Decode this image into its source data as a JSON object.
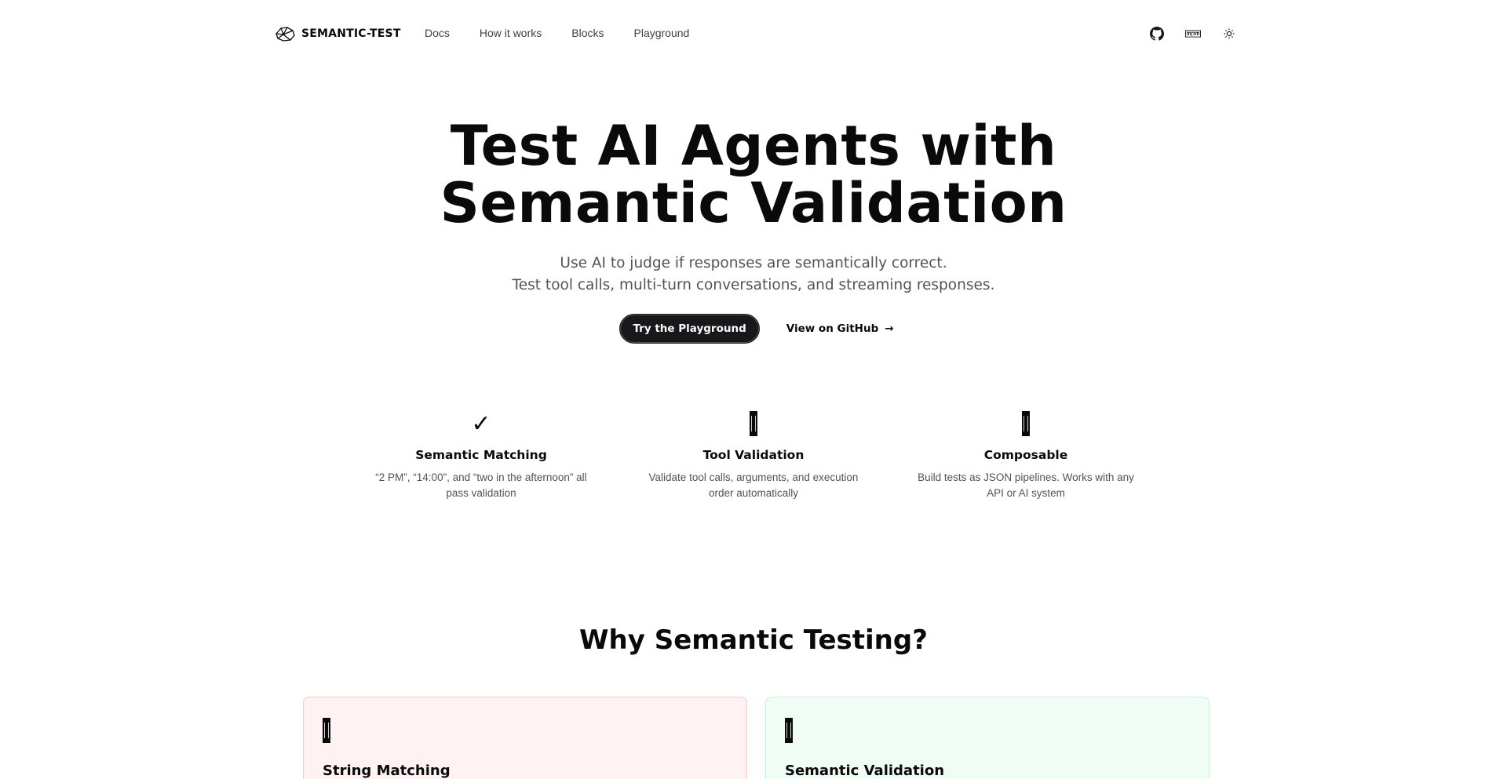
{
  "nav": {
    "brand": "SEMANTIC-TEST",
    "links": [
      "Docs",
      "How it works",
      "Blocks",
      "Playground"
    ],
    "icons": [
      "github-icon",
      "npm-icon",
      "theme-toggle-icon"
    ]
  },
  "hero": {
    "title_line1": "Test AI Agents with",
    "title_line2": "Semantic Validation",
    "sub_line1": "Use AI to judge if responses are semantically correct.",
    "sub_line2": "Test tool calls, multi-turn conversations, and streaming responses.",
    "primary_cta": "Try the Playground",
    "secondary_cta": "View on GitHub",
    "secondary_arrow": "→"
  },
  "features": [
    {
      "icon": "✓",
      "icon_name": "checkmark-icon",
      "title": "Semantic Matching",
      "desc": "“2 PM”, “14:00”, and “two in the afternoon” all pass validation"
    },
    {
      "icon": "",
      "icon_name": "flag-icon",
      "title": "Tool Validation",
      "desc": "Validate tool calls, arguments, and execution order automatically"
    },
    {
      "icon": "",
      "icon_name": "flag-icon",
      "title": "Composable",
      "desc": "Build tests as JSON pipelines. Works with any API or AI system"
    }
  ],
  "why": {
    "title": "Why Semantic Testing?",
    "cards": [
      {
        "title": "String Matching",
        "tone": "negative",
        "bg": "#fef2f2",
        "border": "#fecaca"
      },
      {
        "title": "Semantic Validation",
        "tone": "positive",
        "bg": "#f0fdf4",
        "border": "#bbf7d0"
      }
    ]
  }
}
